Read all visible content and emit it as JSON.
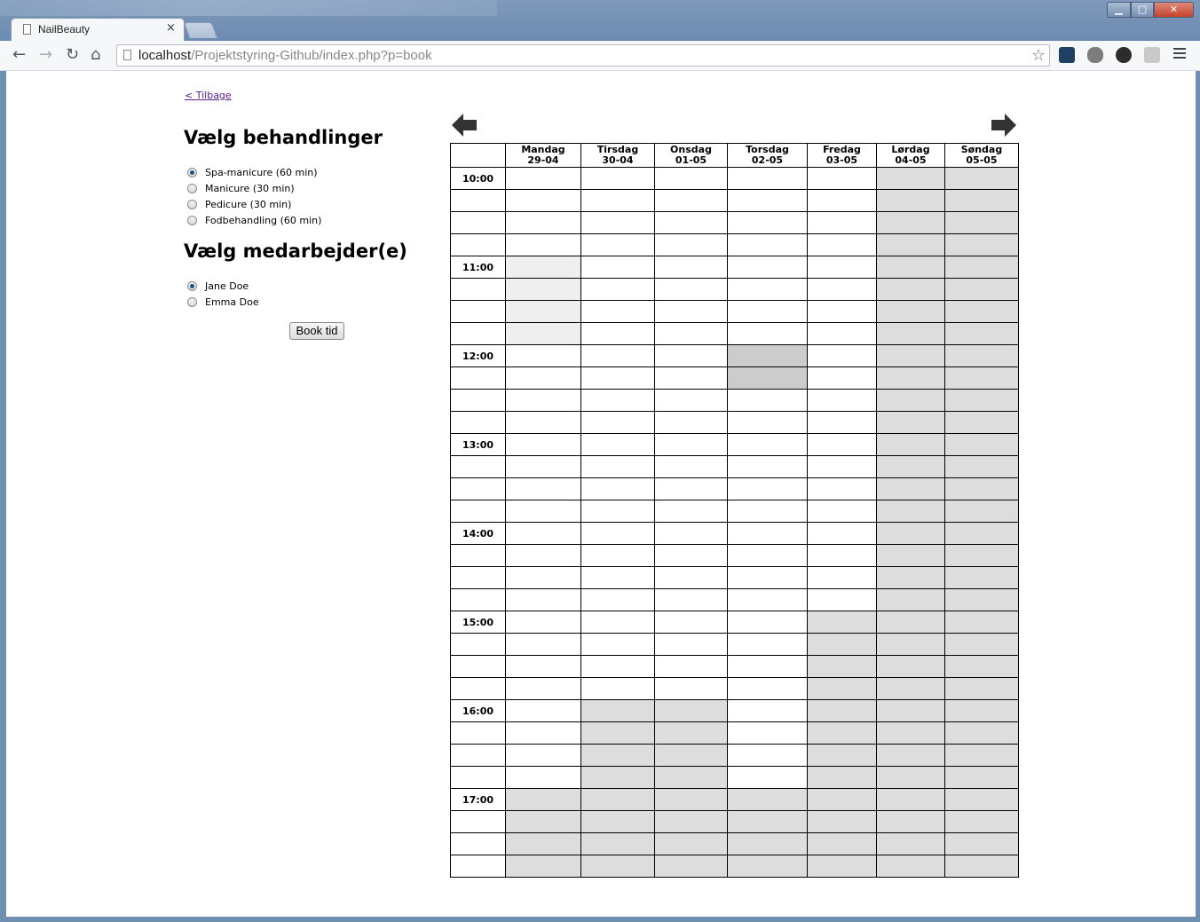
{
  "browser": {
    "tab_title": "NailBeauty",
    "tab_close": "×",
    "url_host": "localhost",
    "url_path": "/Projektstyring-Github/index.php?p=book",
    "window_controls": {
      "minimize": "▁",
      "maximize": "□",
      "close": "✕"
    }
  },
  "page": {
    "back_link": "< Tilbage",
    "treatments_heading": "Vælg behandlinger",
    "treatments": [
      {
        "label": "Spa-manicure (60 min)",
        "checked": true
      },
      {
        "label": "Manicure (30 min)",
        "checked": false
      },
      {
        "label": "Pedicure (30 min)",
        "checked": false
      },
      {
        "label": "Fodbehandling (60 min)",
        "checked": false
      }
    ],
    "employees_heading": "Vælg medarbejder(e)",
    "employees": [
      {
        "label": "Jane Doe",
        "checked": true
      },
      {
        "label": "Emma Doe",
        "checked": false
      }
    ],
    "book_button": "Book tid"
  },
  "calendar": {
    "days": [
      {
        "name": "Mandag",
        "date": "29-04"
      },
      {
        "name": "Tirsdag",
        "date": "30-04"
      },
      {
        "name": "Onsdag",
        "date": "01-05"
      },
      {
        "name": "Torsdag",
        "date": "02-05"
      },
      {
        "name": "Fredag",
        "date": "03-05"
      },
      {
        "name": "Lørdag",
        "date": "04-05"
      },
      {
        "name": "Søndag",
        "date": "05-05"
      }
    ],
    "hours": [
      "10:00",
      "11:00",
      "12:00",
      "13:00",
      "14:00",
      "15:00",
      "16:00",
      "17:00"
    ],
    "slots_per_hour": 4,
    "slot_status": [
      "ooooocc",
      "ooooocc",
      "ooooocc",
      "ooooocc",
      "boooocc",
      "boooocc",
      "boooocc",
      "boooocc",
      "ooorocc",
      "ooorocc",
      "ooooocc",
      "ooooocc",
      "ooooocc",
      "ooooocc",
      "ooooocc",
      "ooooocc",
      "ooooocc",
      "ooooocc",
      "ooooocc",
      "ooooocc",
      "ooooccc",
      "ooooccc",
      "ooooccc",
      "ooooccc",
      "occoccc",
      "occoccc",
      "occoccc",
      "occoccc",
      "ccccccc",
      "ccccccc",
      "ccccccc",
      "ccccccc"
    ],
    "status_colors": {
      "open": "#ffffff",
      "closed": "#dddddd",
      "reserved": "#cccccc",
      "busy": "#efefef"
    },
    "prev_icon": "arrow-left-icon",
    "next_icon": "arrow-right-icon"
  }
}
